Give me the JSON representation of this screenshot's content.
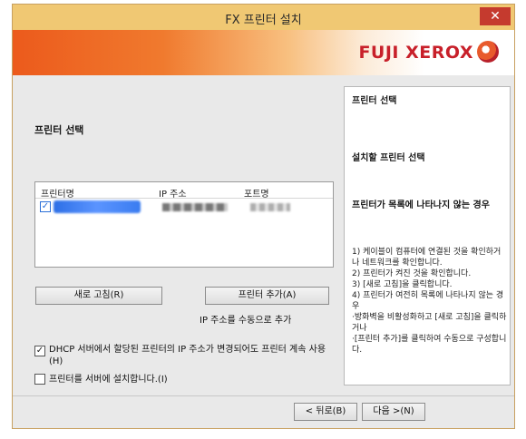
{
  "window": {
    "title": "FX 프린터 설치",
    "close_label": "✕"
  },
  "branding": {
    "logo_text": "FUJI XEROX"
  },
  "main": {
    "section_title": "프린터 선택",
    "columns": [
      "프린터명",
      "IP 주소",
      "포트명"
    ],
    "printer_row": {
      "checked": "✓"
    },
    "refresh_button": "새로 고침(R)",
    "add_button": "프린터 추가(A)",
    "manual_ip_label": "IP 주소를 수동으로 추가",
    "dhcp_option": "DHCP 서버에서 할당된 프린터의 IP 주소가 변경되어도 프린터 계속 사용(H)",
    "dhcp_checked": "✓",
    "server_option": "프린터를 서버에 설치합니다.(I)"
  },
  "help": {
    "title": "프린터 선택",
    "heading1": "설치할 프린터 선택",
    "heading2": "프린터가 목록에 나타나지 않는 경우",
    "body": "1) 케이블이 컴퓨터에 연결된 것을 확인하거나 네트워크를 확인합니다.\n2) 프린터가 켜진 것을 확인합니다.\n3) [새로 고침]을 클릭합니다.\n4) 프린터가 여전히 목록에 나타나지 않는 경우\n ·방화벽을 비활성화하고 [새로 고침]을 클릭하거나\n ·[프린터 추가]를 클릭하여 수동으로 구성합니다."
  },
  "footer": {
    "back_button": "< 뒤로(B)",
    "next_button": "다음 >(N)"
  }
}
